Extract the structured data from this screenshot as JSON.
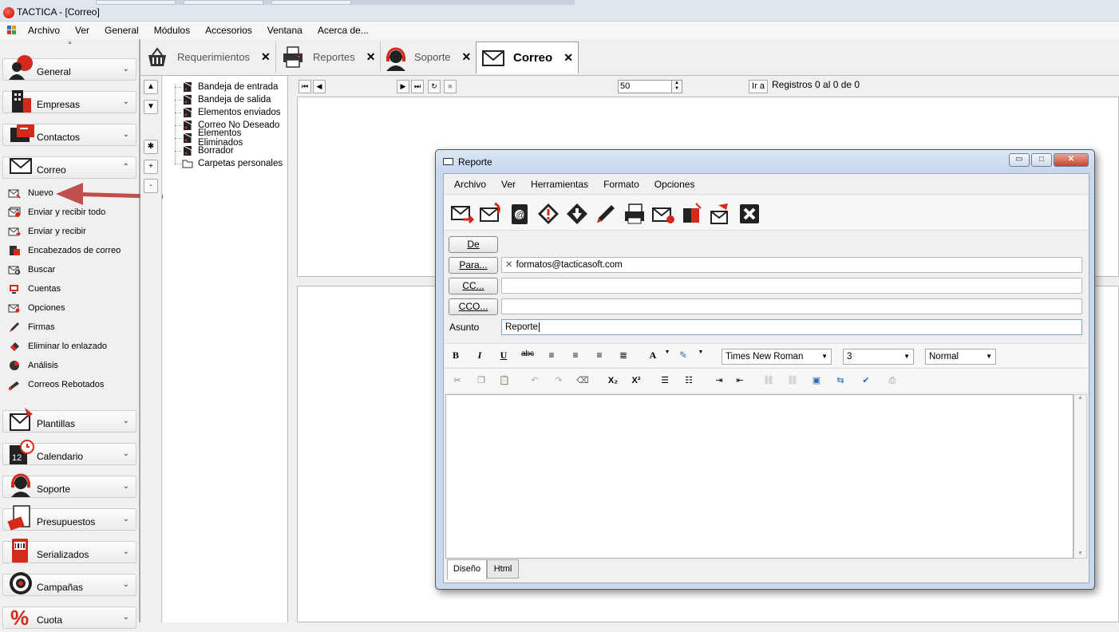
{
  "window": {
    "title": "TACTICA - [Correo]"
  },
  "menu": [
    "Archivo",
    "Ver",
    "General",
    "Módulos",
    "Accesorios",
    "Ventana",
    "Acerca de..."
  ],
  "sidebar": {
    "groups_top": [
      {
        "label": "General",
        "icon": "user-globe-icon"
      },
      {
        "label": "Empresas",
        "icon": "building-icon"
      },
      {
        "label": "Contactos",
        "icon": "contact-card-icon"
      },
      {
        "label": "Correo",
        "icon": "envelope-icon",
        "expanded": true
      }
    ],
    "correo_items": [
      {
        "label": "Nuevo",
        "icon": "new-mail-icon"
      },
      {
        "label": "Enviar y recibir todo",
        "icon": "send-receive-all-icon"
      },
      {
        "label": "Enviar y recibir",
        "icon": "send-receive-icon"
      },
      {
        "label": "Encabezados de correo",
        "icon": "mail-headers-icon"
      },
      {
        "label": "Buscar",
        "icon": "search-mail-icon"
      },
      {
        "label": "Cuentas",
        "icon": "accounts-icon"
      },
      {
        "label": "Opciones",
        "icon": "options-icon"
      },
      {
        "label": "Firmas",
        "icon": "pen-icon"
      },
      {
        "label": "Eliminar lo enlazado",
        "icon": "eraser-icon"
      },
      {
        "label": "Análisis",
        "icon": "pie-chart-icon"
      },
      {
        "label": "Correos Rebotados",
        "icon": "bounced-mail-icon"
      }
    ],
    "groups_bottom": [
      {
        "label": "Plantillas",
        "icon": "template-icon"
      },
      {
        "label": "Calendario",
        "icon": "calendar-icon"
      },
      {
        "label": "Soporte",
        "icon": "headset-icon"
      },
      {
        "label": "Presupuestos",
        "icon": "budget-icon"
      },
      {
        "label": "Serializados",
        "icon": "barcode-icon"
      },
      {
        "label": "Campañas",
        "icon": "target-icon"
      },
      {
        "label": "Cuota",
        "icon": "percent-icon"
      }
    ]
  },
  "doc_tabs": [
    {
      "label": "Requerimientos",
      "icon": "basket-icon",
      "close": "✕"
    },
    {
      "label": "Reportes",
      "icon": "printer-icon",
      "close": "✕"
    },
    {
      "label": "Soporte",
      "icon": "headset-icon",
      "close": "✕"
    },
    {
      "label": "Correo",
      "icon": "envelope-icon",
      "close": "✕",
      "active": true
    }
  ],
  "nav_buttons": [
    "▲",
    "▼",
    "✱",
    "+",
    "-"
  ],
  "folders": [
    "Bandeja de entrada",
    "Bandeja de salida",
    "Elementos enviados",
    "Correo No Deseado",
    "Elementos Eliminados",
    "Borrador",
    "Carpetas personales"
  ],
  "pager": {
    "page_size": "50",
    "goto_label": "Ir a",
    "records": "Registros 0 al 0 de 0"
  },
  "dialog": {
    "title": "Reporte",
    "window_buttons": {
      "minimize": "▭",
      "maximize": "□",
      "close": "✕"
    },
    "menu": [
      "Archivo",
      "Ver",
      "Herramientas",
      "Formato",
      "Opciones"
    ],
    "toolbar_icons": [
      "send-icon",
      "send-attach-icon",
      "address-book-icon",
      "priority-high-icon",
      "priority-low-icon",
      "signature-pen-icon",
      "print-icon",
      "mail-flag-icon",
      "book-icon",
      "campaign-mail-icon",
      "close-x-icon"
    ],
    "from_label": "De",
    "to_label": "Para...",
    "to_value": "formatos@tacticasoft.com",
    "cc_label": "CC...",
    "bcc_label": "CCO...",
    "subject_label": "Asunto",
    "subject_value": "Reporte",
    "format": {
      "bold": "B",
      "italic": "I",
      "underline": "U",
      "strike": "abc",
      "font": "Times New Roman",
      "size": "3",
      "style": "Normal"
    },
    "editor_tabs": [
      "Diseño",
      "Html"
    ]
  },
  "colors": {
    "arrow": "#c0504d",
    "accent_red": "#d42a1c"
  }
}
